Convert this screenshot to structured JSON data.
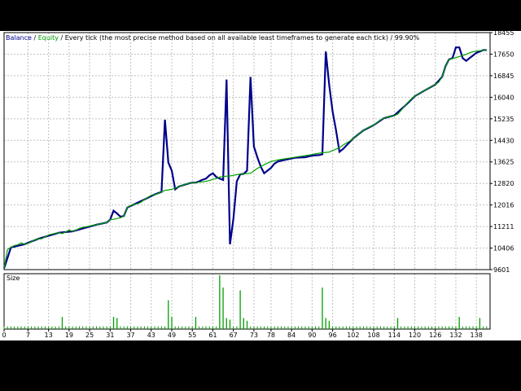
{
  "header": {
    "balance_label": "Balance",
    "sep1": " / ",
    "equity_label": "Equity",
    "description": " / Every tick (the most precise method based on all available least timeframes to generate each tick) / 99.90%"
  },
  "size_panel": {
    "label": "Size"
  },
  "colors": {
    "balance": "#00008B",
    "equity": "#00A000",
    "text": "#000000",
    "grid": "#C0C0C0",
    "size_bars": "#00A000"
  },
  "chart_data": [
    {
      "type": "line",
      "title": "",
      "y_ticks": [
        "18455",
        "17650",
        "16845",
        "16040",
        "15235",
        "14430",
        "13625",
        "12820",
        "12016",
        "11211",
        "10406",
        "9601"
      ],
      "ylim": [
        9601,
        18455
      ],
      "xlim": [
        0,
        142
      ],
      "series": [
        {
          "name": "Balance",
          "points": [
            [
              0,
              9650
            ],
            [
              1,
              10350
            ],
            [
              2,
              10430
            ],
            [
              3,
              10500
            ],
            [
              4,
              10530
            ],
            [
              5,
              10600
            ],
            [
              6,
              10550
            ],
            [
              7,
              10580
            ],
            [
              8,
              10640
            ],
            [
              9,
              10720
            ],
            [
              10,
              10750
            ],
            [
              11,
              10750
            ],
            [
              12,
              10820
            ],
            [
              13,
              10900
            ],
            [
              14,
              10930
            ],
            [
              15,
              10960
            ],
            [
              16,
              10980
            ],
            [
              17,
              10950
            ],
            [
              18,
              11010
            ],
            [
              19,
              11080
            ],
            [
              20,
              11030
            ],
            [
              21,
              11080
            ],
            [
              22,
              11140
            ],
            [
              23,
              11180
            ],
            [
              24,
              11200
            ],
            [
              25,
              11230
            ],
            [
              26,
              11260
            ],
            [
              27,
              11280
            ],
            [
              28,
              11310
            ],
            [
              29,
              11330
            ],
            [
              30,
              11360
            ],
            [
              31,
              11470
            ],
            [
              32,
              11480
            ],
            [
              33,
              11510
            ],
            [
              34,
              11540
            ],
            [
              35,
              11600
            ],
            [
              36,
              11920
            ],
            [
              37,
              12000
            ],
            [
              38,
              12040
            ],
            [
              39,
              12060
            ],
            [
              40,
              12120
            ],
            [
              41,
              12220
            ],
            [
              42,
              12300
            ],
            [
              43,
              12380
            ],
            [
              44,
              12410
            ],
            [
              45,
              12440
            ],
            [
              46,
              12500
            ],
            [
              47,
              12560
            ],
            [
              48,
              12580
            ],
            [
              49,
              12600
            ],
            [
              50,
              12640
            ],
            [
              51,
              12700
            ],
            [
              52,
              12740
            ],
            [
              53,
              12790
            ],
            [
              54,
              12820
            ],
            [
              55,
              12840
            ],
            [
              56,
              12850
            ],
            [
              57,
              12870
            ],
            [
              58,
              12880
            ],
            [
              59,
              12900
            ],
            [
              60,
              12930
            ],
            [
              61,
              12980
            ],
            [
              62,
              13000
            ],
            [
              63,
              13060
            ],
            [
              64,
              13080
            ],
            [
              65,
              13090
            ],
            [
              66,
              13100
            ],
            [
              67,
              13120
            ],
            [
              68,
              13150
            ],
            [
              69,
              13160
            ],
            [
              70,
              13180
            ],
            [
              71,
              13190
            ],
            [
              72,
              13200
            ],
            [
              73,
              13290
            ],
            [
              74,
              13380
            ],
            [
              75,
              13450
            ],
            [
              76,
              13520
            ],
            [
              77,
              13580
            ],
            [
              78,
              13640
            ],
            [
              79,
              13670
            ],
            [
              80,
              13700
            ],
            [
              81,
              13720
            ],
            [
              82,
              13740
            ],
            [
              83,
              13760
            ],
            [
              84,
              13780
            ],
            [
              85,
              13800
            ],
            [
              86,
              13820
            ],
            [
              87,
              13840
            ],
            [
              88,
              13860
            ],
            [
              89,
              13880
            ],
            [
              90,
              13900
            ],
            [
              91,
              13930
            ],
            [
              92,
              13950
            ],
            [
              93,
              13970
            ],
            [
              94,
              13980
            ],
            [
              95,
              13990
            ],
            [
              96,
              14050
            ],
            [
              97,
              14100
            ],
            [
              98,
              14160
            ],
            [
              99,
              14250
            ],
            [
              100,
              14330
            ],
            [
              101,
              14400
            ],
            [
              102,
              14500
            ],
            [
              103,
              14600
            ],
            [
              104,
              14700
            ],
            [
              105,
              14800
            ],
            [
              106,
              14880
            ],
            [
              107,
              14950
            ],
            [
              108,
              15000
            ],
            [
              109,
              15100
            ],
            [
              110,
              15200
            ],
            [
              111,
              15260
            ],
            [
              112,
              15300
            ],
            [
              113,
              15320
            ],
            [
              114,
              15360
            ],
            [
              115,
              15400
            ],
            [
              116,
              15550
            ],
            [
              117,
              15700
            ],
            [
              118,
              15850
            ],
            [
              119,
              15980
            ],
            [
              120,
              16080
            ],
            [
              121,
              16160
            ],
            [
              122,
              16230
            ],
            [
              123,
              16300
            ],
            [
              124,
              16380
            ],
            [
              125,
              16450
            ],
            [
              126,
              16510
            ],
            [
              127,
              16600
            ],
            [
              128,
              16800
            ],
            [
              129,
              17200
            ],
            [
              130,
              17450
            ],
            [
              131,
              17480
            ],
            [
              132,
              17520
            ],
            [
              133,
              17560
            ],
            [
              134,
              17600
            ],
            [
              135,
              17640
            ],
            [
              136,
              17700
            ],
            [
              137,
              17740
            ],
            [
              138,
              17760
            ],
            [
              139,
              17780
            ],
            [
              140,
              17790
            ],
            [
              141,
              17800
            ]
          ]
        },
        {
          "name": "Equity",
          "points": [
            [
              0,
              9650
            ],
            [
              2,
              10430
            ],
            [
              6,
              10550
            ],
            [
              10,
              10750
            ],
            [
              16,
              10980
            ],
            [
              20,
              11030
            ],
            [
              27,
              11280
            ],
            [
              30,
              11360
            ],
            [
              31,
              11470
            ],
            [
              32,
              11800
            ],
            [
              33,
              11700
            ],
            [
              34,
              11580
            ],
            [
              35,
              11600
            ],
            [
              36,
              11920
            ],
            [
              41,
              12220
            ],
            [
              44,
              12410
            ],
            [
              46,
              12500
            ],
            [
              47,
              15200
            ],
            [
              48,
              13600
            ],
            [
              49,
              13300
            ],
            [
              50,
              12600
            ],
            [
              51,
              12700
            ],
            [
              54,
              12820
            ],
            [
              55,
              12850
            ],
            [
              56,
              12850
            ],
            [
              57,
              12900
            ],
            [
              58,
              12960
            ],
            [
              59,
              13000
            ],
            [
              60,
              13120
            ],
            [
              61,
              13200
            ],
            [
              62,
              13060
            ],
            [
              63,
              13000
            ],
            [
              64,
              12950
            ],
            [
              65,
              16700
            ],
            [
              66,
              10550
            ],
            [
              67,
              11500
            ],
            [
              68,
              12900
            ],
            [
              69,
              13160
            ],
            [
              70,
              13180
            ],
            [
              71,
              13300
            ],
            [
              72,
              16800
            ],
            [
              73,
              14200
            ],
            [
              74,
              13800
            ],
            [
              75,
              13450
            ],
            [
              76,
              13200
            ],
            [
              77,
              13300
            ],
            [
              78,
              13400
            ],
            [
              79,
              13560
            ],
            [
              80,
              13640
            ],
            [
              81,
              13670
            ],
            [
              82,
              13700
            ],
            [
              85,
              13780
            ],
            [
              88,
              13800
            ],
            [
              90,
              13860
            ],
            [
              92,
              13880
            ],
            [
              93,
              13910
            ],
            [
              94,
              17750
            ],
            [
              95,
              16500
            ],
            [
              96,
              15500
            ],
            [
              97,
              14800
            ],
            [
              98,
              14000
            ],
            [
              99,
              14100
            ],
            [
              102,
              14500
            ],
            [
              105,
              14800
            ],
            [
              108,
              15000
            ],
            [
              111,
              15260
            ],
            [
              114,
              15360
            ],
            [
              117,
              15700
            ],
            [
              120,
              16080
            ],
            [
              123,
              16300
            ],
            [
              126,
              16510
            ],
            [
              128,
              16800
            ],
            [
              129,
              17200
            ],
            [
              130,
              17450
            ],
            [
              131,
              17500
            ],
            [
              132,
              17900
            ],
            [
              133,
              17900
            ],
            [
              134,
              17500
            ],
            [
              135,
              17400
            ],
            [
              136,
              17500
            ],
            [
              137,
              17600
            ],
            [
              138,
              17700
            ],
            [
              139,
              17750
            ],
            [
              140,
              17800
            ],
            [
              141,
              17800
            ]
          ]
        }
      ]
    },
    {
      "type": "bar",
      "title": "",
      "x_ticks": [
        "0",
        "7",
        "13",
        "19",
        "25",
        "31",
        "37",
        "43",
        "49",
        "55",
        "61",
        "67",
        "73",
        "78",
        "84",
        "90",
        "96",
        "102",
        "108",
        "114",
        "120",
        "126",
        "132",
        "138"
      ],
      "bars": [
        [
          17,
          0.22
        ],
        [
          32,
          0.22
        ],
        [
          33,
          0.2
        ],
        [
          48,
          0.52
        ],
        [
          49,
          0.22
        ],
        [
          56,
          0.22
        ],
        [
          63,
          0.97
        ],
        [
          64,
          0.75
        ],
        [
          65,
          0.2
        ],
        [
          66,
          0.17
        ],
        [
          69,
          0.7
        ],
        [
          70,
          0.2
        ],
        [
          71,
          0.15
        ],
        [
          93,
          0.75
        ],
        [
          94,
          0.2
        ],
        [
          95,
          0.15
        ],
        [
          115,
          0.2
        ],
        [
          133,
          0.22
        ],
        [
          139,
          0.2
        ]
      ],
      "bar_baseline": 0.05
    }
  ]
}
